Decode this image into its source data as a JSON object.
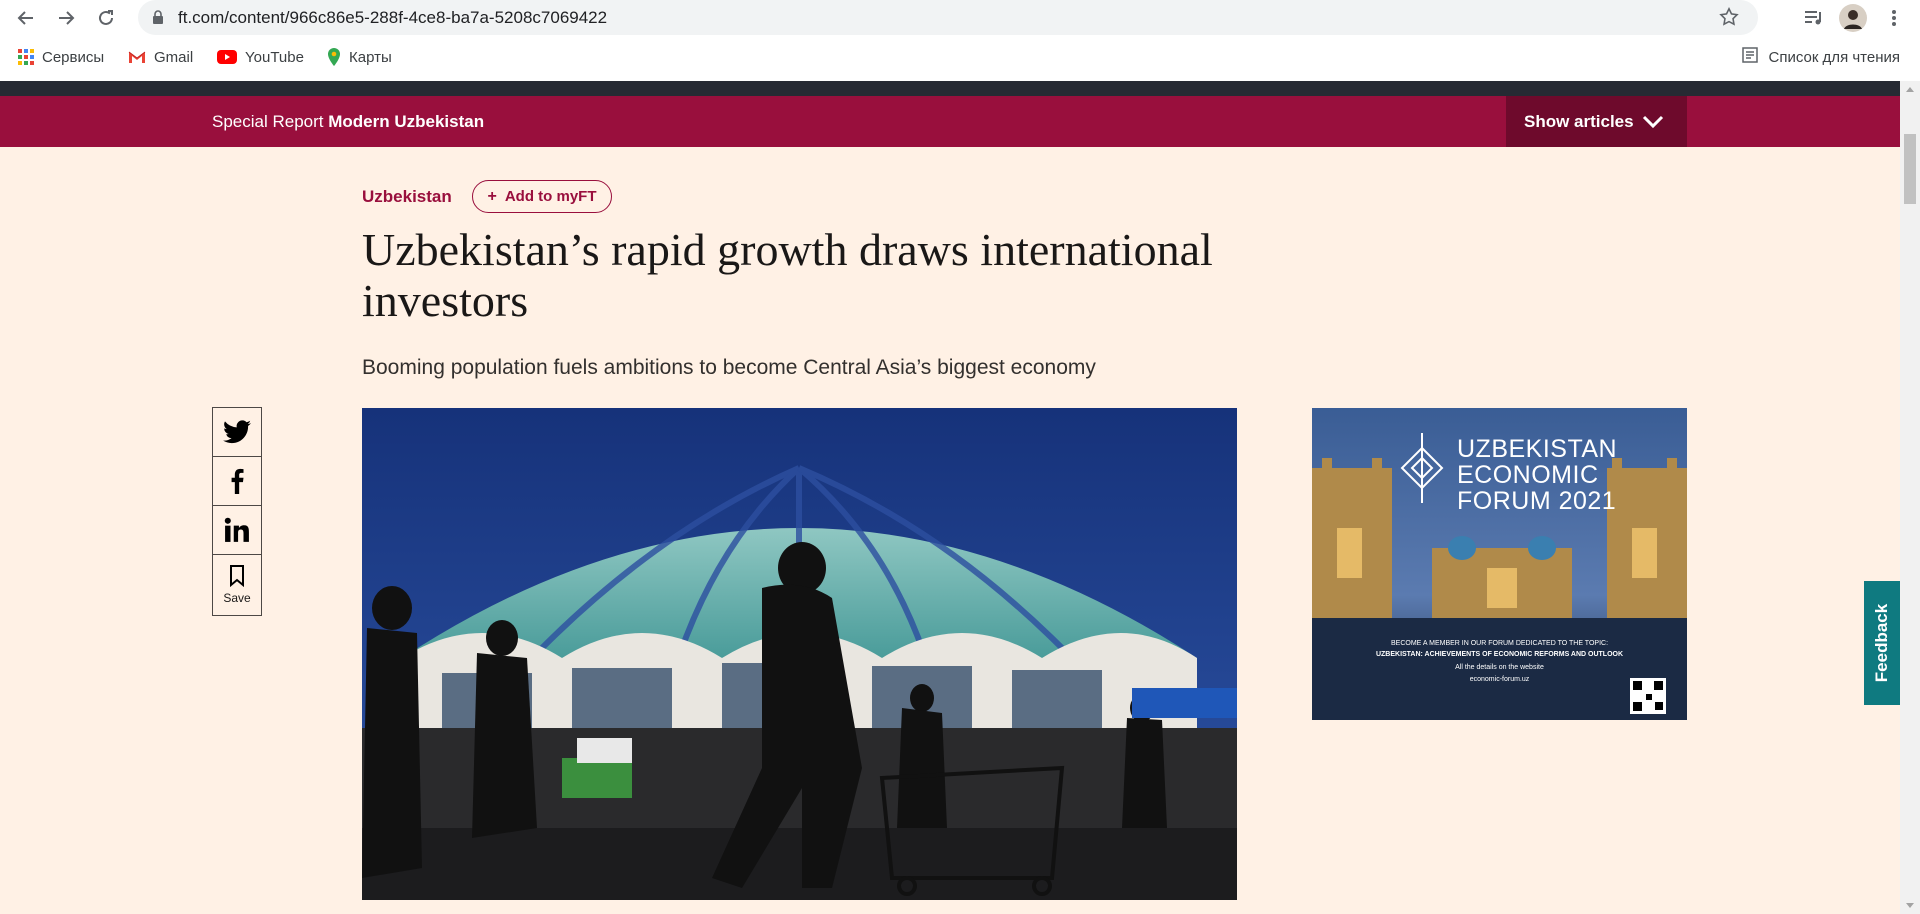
{
  "browser": {
    "url": "ft.com/content/966c86e5-288f-4ce8-ba7a-5208c7069422",
    "bookmarks": [
      {
        "label": "Сервисы",
        "icon": "apps-grid-icon"
      },
      {
        "label": "Gmail",
        "icon": "gmail-icon"
      },
      {
        "label": "YouTube",
        "icon": "youtube-icon"
      },
      {
        "label": "Карты",
        "icon": "maps-pin-icon"
      }
    ],
    "reading_list": "Список для чтения"
  },
  "report_bar": {
    "prefix": "Special Report",
    "title": "Modern Uzbekistan",
    "show_articles": "Show articles"
  },
  "article": {
    "topic": "Uzbekistan",
    "add_myft": "Add to myFT",
    "headline": "Uzbekistan’s rapid growth draws international investors",
    "standfirst": "Booming population fuels ambitions to become Central Asia’s biggest economy",
    "save_label": "Save"
  },
  "ad": {
    "title_line1": "UZBEKISTAN",
    "title_line2": "ECONOMIC",
    "title_line3": "FORUM 2021",
    "member_line": "BECOME A MEMBER IN OUR FORUM DEDICATED TO THE TOPIC:",
    "topic_line": "UZBEKISTAN: ACHIEVEMENTS OF ECONOMIC REFORMS AND OUTLOOK",
    "details_line": "All the details on the website",
    "website": "economic-forum.uz"
  },
  "feedback_label": "Feedback",
  "colors": {
    "page_bg": "#fff1e5",
    "claret": "#990f3d",
    "dark_claret": "#6e0a2c",
    "teal": "#0f7a80"
  }
}
